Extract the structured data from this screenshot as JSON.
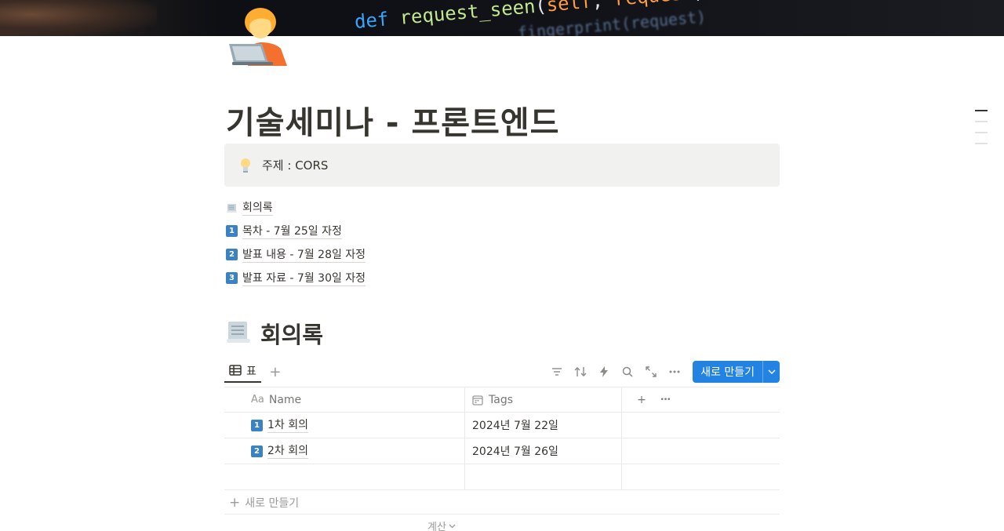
{
  "cover": {
    "code_line_1": {
      "kw": "def ",
      "fn": "request_seen",
      "open": "(",
      "a1": "self",
      "sep": ", ",
      "a2": "request",
      "close": "):"
    },
    "code_line_2": "   fingerprint(request)"
  },
  "page": {
    "icon": "technologist-emoji",
    "title": "기술세미나 - 프론트엔드"
  },
  "callout": {
    "icon": "lightbulb-icon",
    "text": "주제 : CORS"
  },
  "links": [
    {
      "icon": "scroll-icon",
      "label": "회의록"
    },
    {
      "badge": "1",
      "label": "목차 - 7월 25일 자정"
    },
    {
      "badge": "2",
      "label": "발표 내용 - 7월 28일 자정"
    },
    {
      "badge": "3",
      "label": "발표 자료 - 7월 30일 자정"
    }
  ],
  "section": {
    "icon": "scroll-icon",
    "title": "회의록"
  },
  "view": {
    "tab_label": "표",
    "add_view": "+",
    "new_button": "새로 만들기"
  },
  "table": {
    "columns": [
      {
        "prefix": "Aa",
        "label": "Name"
      },
      {
        "label": "Tags"
      }
    ],
    "header_add": "+",
    "header_more": "•••",
    "rows": [
      {
        "badge": "1",
        "name": "1차 회의",
        "tags": "2024년 7월 22일"
      },
      {
        "badge": "2",
        "name": "2차 회의",
        "tags": "2024년 7월 26일"
      }
    ]
  },
  "new_row_label": "새로 만들기",
  "calc_label": "계산",
  "colors": {
    "accent": "#2383e2",
    "badge": "#3b82c4",
    "text": "#37352f",
    "callout_bg": "#f1f1ef"
  }
}
